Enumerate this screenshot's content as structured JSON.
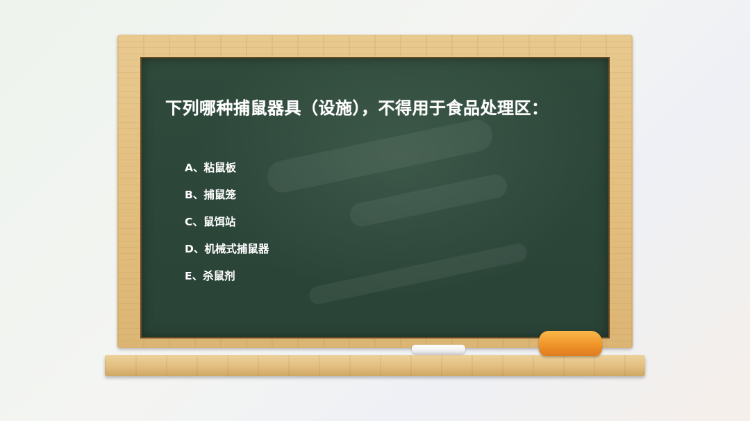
{
  "question": {
    "title": "下列哪种捕鼠器具（设施），不得用于食品处理区："
  },
  "options": [
    {
      "label": "A、粘鼠板"
    },
    {
      "label": "B、捕鼠笼"
    },
    {
      "label": "C、鼠饵站"
    },
    {
      "label": "D、机械式捕鼠器"
    },
    {
      "label": "E、杀鼠剂"
    }
  ],
  "colors": {
    "board": "#2e483a",
    "frame": "#e3bf80",
    "eraser": "#f0952a",
    "text": "#ffffff"
  }
}
